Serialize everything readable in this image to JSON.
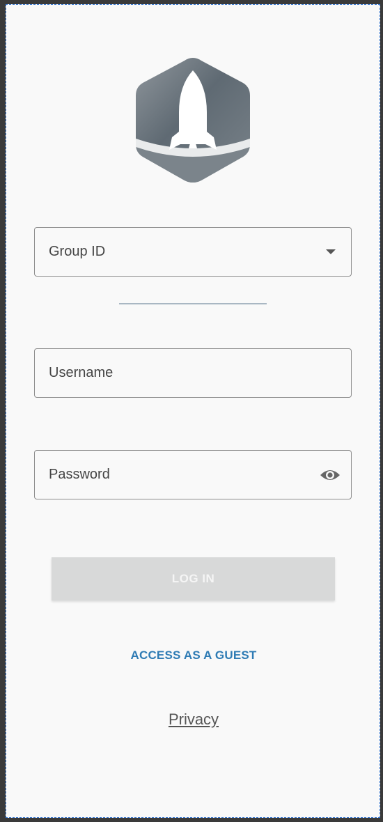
{
  "app": {
    "logo_icon": "rocket-hexagon-logo"
  },
  "form": {
    "group_id": {
      "placeholder": "Group ID",
      "icon": "chevron-down-icon"
    },
    "username": {
      "placeholder": "Username"
    },
    "password": {
      "placeholder": "Password",
      "icon": "eye-icon"
    }
  },
  "actions": {
    "login_label": "LOG IN",
    "guest_label": "ACCESS AS A GUEST",
    "privacy_label": "Privacy"
  },
  "colors": {
    "background": "#f9f9f9",
    "login_disabled": "#d8d9d9",
    "link_accent": "#2e7bb4",
    "divider": "#a9b7c3"
  }
}
